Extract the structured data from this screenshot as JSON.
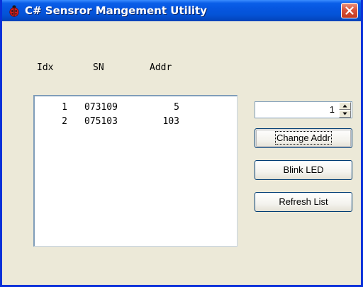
{
  "window": {
    "title": "C# Sensror Mangement Utility",
    "app_icon": "ladybug-icon",
    "close_icon": "close-icon"
  },
  "colors": {
    "titlebar": "#0A5EE8",
    "window_face": "#ECE9D8",
    "close_button": "#D9533A",
    "list_border": "#7F9DB9"
  },
  "list": {
    "headers": {
      "idx": "Idx",
      "sn": "SN",
      "addr": "Addr"
    },
    "rows": [
      {
        "idx": "1",
        "sn": "073109",
        "addr": "5"
      },
      {
        "idx": "2",
        "sn": "075103",
        "addr": "103"
      }
    ]
  },
  "address_spinner": {
    "value": "1"
  },
  "buttons": {
    "change_addr": "Change Addr",
    "blink_led": "Blink LED",
    "refresh_list": "Refresh List"
  }
}
